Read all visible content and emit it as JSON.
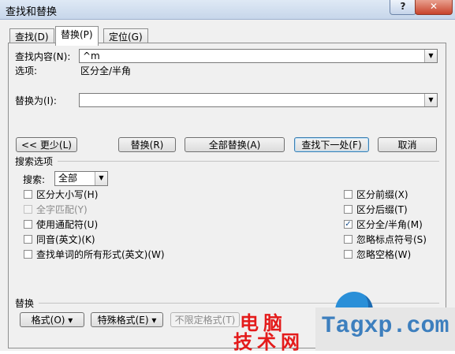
{
  "window": {
    "title": "查找和替换",
    "help_label": "?",
    "close_label": "✕"
  },
  "tabs": [
    {
      "label": "查找(D)",
      "active": false
    },
    {
      "label": "替换(P)",
      "active": true
    },
    {
      "label": "定位(G)",
      "active": false
    }
  ],
  "find": {
    "label": "查找内容(N):",
    "value": "^m",
    "options_label": "选项:",
    "options_value": "区分全/半角"
  },
  "replace": {
    "label": "替换为(I):",
    "value": ""
  },
  "buttons": {
    "less": "<< 更少(L)",
    "replace": "替换(R)",
    "replace_all": "全部替换(A)",
    "find_next": "查找下一处(F)",
    "cancel": "取消"
  },
  "search_options": {
    "header": "搜索选项",
    "search_label": "搜索:",
    "search_value": "全部",
    "left": [
      {
        "label": "区分大小写(H)",
        "checked": false,
        "disabled": false
      },
      {
        "label": "全字匹配(Y)",
        "checked": false,
        "disabled": true
      },
      {
        "label": "使用通配符(U)",
        "checked": false,
        "disabled": false
      },
      {
        "label": "同音(英文)(K)",
        "checked": false,
        "disabled": false
      },
      {
        "label": "查找单词的所有形式(英文)(W)",
        "checked": false,
        "disabled": false
      }
    ],
    "right": [
      {
        "label": "区分前缀(X)",
        "checked": false
      },
      {
        "label": "区分后缀(T)",
        "checked": false
      },
      {
        "label": "区分全/半角(M)",
        "checked": true
      },
      {
        "label": "忽略标点符号(S)",
        "checked": false
      },
      {
        "label": "忽略空格(W)",
        "checked": false
      }
    ]
  },
  "replace_section": {
    "header": "替换",
    "format": "格式(O) ▾",
    "special": "特殊格式(E) ▾",
    "no_format": "不限定格式(T)"
  },
  "watermark": {
    "line1": "电脑",
    "line2": "技术网",
    "site": "Tagxp.com"
  }
}
